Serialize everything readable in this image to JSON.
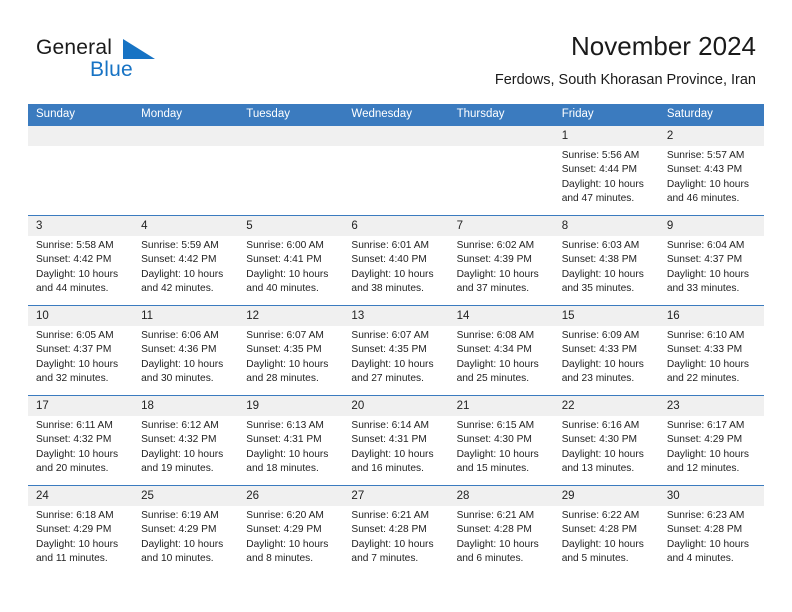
{
  "brand": {
    "word1": "General",
    "word2": "Blue",
    "mark": "triangle-flag-icon",
    "accent_color": "#1773c4"
  },
  "header": {
    "title": "November 2024",
    "subtitle": "Ferdows, South Khorasan Province, Iran"
  },
  "theme": {
    "header_blue": "#3b7bbf",
    "daynum_band": "#f0f0f0",
    "text": "#222222"
  },
  "weekdays": [
    "Sunday",
    "Monday",
    "Tuesday",
    "Wednesday",
    "Thursday",
    "Friday",
    "Saturday"
  ],
  "labels": {
    "sunrise": "Sunrise:",
    "sunset": "Sunset:",
    "daylight": "Daylight:"
  },
  "weeks": [
    [
      {
        "day": "",
        "empty": true
      },
      {
        "day": "",
        "empty": true
      },
      {
        "day": "",
        "empty": true
      },
      {
        "day": "",
        "empty": true
      },
      {
        "day": "",
        "empty": true
      },
      {
        "day": "1",
        "sunrise": "Sunrise: 5:56 AM",
        "sunset": "Sunset: 4:44 PM",
        "daylight1": "Daylight: 10 hours",
        "daylight2": "and 47 minutes."
      },
      {
        "day": "2",
        "sunrise": "Sunrise: 5:57 AM",
        "sunset": "Sunset: 4:43 PM",
        "daylight1": "Daylight: 10 hours",
        "daylight2": "and 46 minutes."
      }
    ],
    [
      {
        "day": "3",
        "sunrise": "Sunrise: 5:58 AM",
        "sunset": "Sunset: 4:42 PM",
        "daylight1": "Daylight: 10 hours",
        "daylight2": "and 44 minutes."
      },
      {
        "day": "4",
        "sunrise": "Sunrise: 5:59 AM",
        "sunset": "Sunset: 4:42 PM",
        "daylight1": "Daylight: 10 hours",
        "daylight2": "and 42 minutes."
      },
      {
        "day": "5",
        "sunrise": "Sunrise: 6:00 AM",
        "sunset": "Sunset: 4:41 PM",
        "daylight1": "Daylight: 10 hours",
        "daylight2": "and 40 minutes."
      },
      {
        "day": "6",
        "sunrise": "Sunrise: 6:01 AM",
        "sunset": "Sunset: 4:40 PM",
        "daylight1": "Daylight: 10 hours",
        "daylight2": "and 38 minutes."
      },
      {
        "day": "7",
        "sunrise": "Sunrise: 6:02 AM",
        "sunset": "Sunset: 4:39 PM",
        "daylight1": "Daylight: 10 hours",
        "daylight2": "and 37 minutes."
      },
      {
        "day": "8",
        "sunrise": "Sunrise: 6:03 AM",
        "sunset": "Sunset: 4:38 PM",
        "daylight1": "Daylight: 10 hours",
        "daylight2": "and 35 minutes."
      },
      {
        "day": "9",
        "sunrise": "Sunrise: 6:04 AM",
        "sunset": "Sunset: 4:37 PM",
        "daylight1": "Daylight: 10 hours",
        "daylight2": "and 33 minutes."
      }
    ],
    [
      {
        "day": "10",
        "sunrise": "Sunrise: 6:05 AM",
        "sunset": "Sunset: 4:37 PM",
        "daylight1": "Daylight: 10 hours",
        "daylight2": "and 32 minutes."
      },
      {
        "day": "11",
        "sunrise": "Sunrise: 6:06 AM",
        "sunset": "Sunset: 4:36 PM",
        "daylight1": "Daylight: 10 hours",
        "daylight2": "and 30 minutes."
      },
      {
        "day": "12",
        "sunrise": "Sunrise: 6:07 AM",
        "sunset": "Sunset: 4:35 PM",
        "daylight1": "Daylight: 10 hours",
        "daylight2": "and 28 minutes."
      },
      {
        "day": "13",
        "sunrise": "Sunrise: 6:07 AM",
        "sunset": "Sunset: 4:35 PM",
        "daylight1": "Daylight: 10 hours",
        "daylight2": "and 27 minutes."
      },
      {
        "day": "14",
        "sunrise": "Sunrise: 6:08 AM",
        "sunset": "Sunset: 4:34 PM",
        "daylight1": "Daylight: 10 hours",
        "daylight2": "and 25 minutes."
      },
      {
        "day": "15",
        "sunrise": "Sunrise: 6:09 AM",
        "sunset": "Sunset: 4:33 PM",
        "daylight1": "Daylight: 10 hours",
        "daylight2": "and 23 minutes."
      },
      {
        "day": "16",
        "sunrise": "Sunrise: 6:10 AM",
        "sunset": "Sunset: 4:33 PM",
        "daylight1": "Daylight: 10 hours",
        "daylight2": "and 22 minutes."
      }
    ],
    [
      {
        "day": "17",
        "sunrise": "Sunrise: 6:11 AM",
        "sunset": "Sunset: 4:32 PM",
        "daylight1": "Daylight: 10 hours",
        "daylight2": "and 20 minutes."
      },
      {
        "day": "18",
        "sunrise": "Sunrise: 6:12 AM",
        "sunset": "Sunset: 4:32 PM",
        "daylight1": "Daylight: 10 hours",
        "daylight2": "and 19 minutes."
      },
      {
        "day": "19",
        "sunrise": "Sunrise: 6:13 AM",
        "sunset": "Sunset: 4:31 PM",
        "daylight1": "Daylight: 10 hours",
        "daylight2": "and 18 minutes."
      },
      {
        "day": "20",
        "sunrise": "Sunrise: 6:14 AM",
        "sunset": "Sunset: 4:31 PM",
        "daylight1": "Daylight: 10 hours",
        "daylight2": "and 16 minutes."
      },
      {
        "day": "21",
        "sunrise": "Sunrise: 6:15 AM",
        "sunset": "Sunset: 4:30 PM",
        "daylight1": "Daylight: 10 hours",
        "daylight2": "and 15 minutes."
      },
      {
        "day": "22",
        "sunrise": "Sunrise: 6:16 AM",
        "sunset": "Sunset: 4:30 PM",
        "daylight1": "Daylight: 10 hours",
        "daylight2": "and 13 minutes."
      },
      {
        "day": "23",
        "sunrise": "Sunrise: 6:17 AM",
        "sunset": "Sunset: 4:29 PM",
        "daylight1": "Daylight: 10 hours",
        "daylight2": "and 12 minutes."
      }
    ],
    [
      {
        "day": "24",
        "sunrise": "Sunrise: 6:18 AM",
        "sunset": "Sunset: 4:29 PM",
        "daylight1": "Daylight: 10 hours",
        "daylight2": "and 11 minutes."
      },
      {
        "day": "25",
        "sunrise": "Sunrise: 6:19 AM",
        "sunset": "Sunset: 4:29 PM",
        "daylight1": "Daylight: 10 hours",
        "daylight2": "and 10 minutes."
      },
      {
        "day": "26",
        "sunrise": "Sunrise: 6:20 AM",
        "sunset": "Sunset: 4:29 PM",
        "daylight1": "Daylight: 10 hours",
        "daylight2": "and 8 minutes."
      },
      {
        "day": "27",
        "sunrise": "Sunrise: 6:21 AM",
        "sunset": "Sunset: 4:28 PM",
        "daylight1": "Daylight: 10 hours",
        "daylight2": "and 7 minutes."
      },
      {
        "day": "28",
        "sunrise": "Sunrise: 6:21 AM",
        "sunset": "Sunset: 4:28 PM",
        "daylight1": "Daylight: 10 hours",
        "daylight2": "and 6 minutes."
      },
      {
        "day": "29",
        "sunrise": "Sunrise: 6:22 AM",
        "sunset": "Sunset: 4:28 PM",
        "daylight1": "Daylight: 10 hours",
        "daylight2": "and 5 minutes."
      },
      {
        "day": "30",
        "sunrise": "Sunrise: 6:23 AM",
        "sunset": "Sunset: 4:28 PM",
        "daylight1": "Daylight: 10 hours",
        "daylight2": "and 4 minutes."
      }
    ]
  ]
}
